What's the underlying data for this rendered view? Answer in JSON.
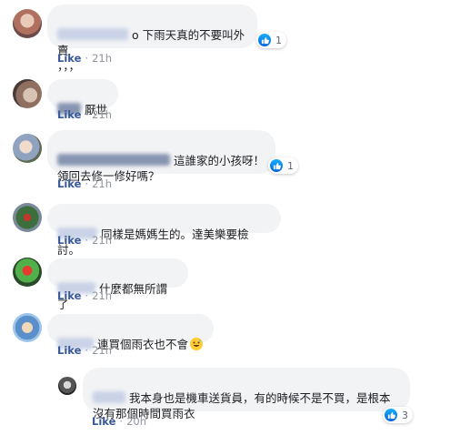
{
  "comments": [
    {
      "text": "o 下雨天真的不要叫外賣\n，，，",
      "reactions": "1",
      "like_label": "Like",
      "time": "21h"
    },
    {
      "text": "厭世",
      "like_label": "Like",
      "time": "21h"
    },
    {
      "text": "這誰家的小孩呀！\n領回去修一修好嗎？",
      "reactions": "1",
      "like_label": "Like",
      "time": "21h"
    },
    {
      "text": "同樣是媽媽生的。達美樂要檢討。",
      "like_label": "Like",
      "time": "21h"
    },
    {
      "text": "什麼都無所謂了",
      "like_label": "Like",
      "time": "21h"
    },
    {
      "text": "連買個雨衣也不會",
      "emoji": "grinning-sweat-emoji",
      "like_label": "Like",
      "time": "21h"
    }
  ],
  "reply": {
    "text": "我本身也是機車送貨員，有的時候不是不買，是根本\n沒有那個時間買雨衣",
    "reactions": "3",
    "like_label": "Like",
    "time": "20h"
  },
  "colors": {
    "bubble": "#f2f3f5",
    "link": "#385898",
    "meta": "#90949c",
    "like_blue": "#0062DF"
  }
}
